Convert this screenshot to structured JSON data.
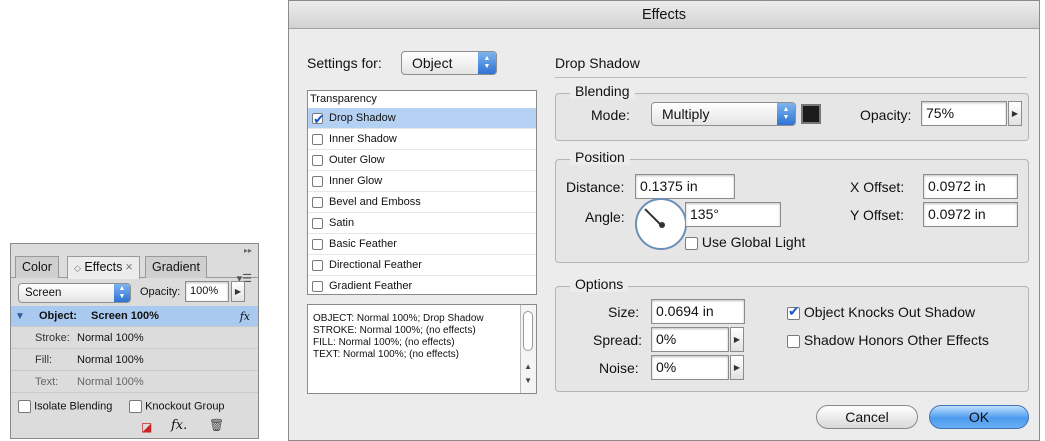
{
  "panel": {
    "tabs": [
      "Color",
      "Effects",
      "Gradient"
    ],
    "blend_mode": "Screen",
    "opacity_label": "Opacity:",
    "opacity_value": "100%",
    "rows": [
      {
        "label": "Object:",
        "value": "Screen 100%"
      },
      {
        "label": "Stroke:",
        "value": "Normal 100%"
      },
      {
        "label": "Fill:",
        "value": "Normal 100%"
      },
      {
        "label": "Text:",
        "value": "Normal 100%"
      }
    ],
    "isolate_blending": "Isolate Blending",
    "knockout_group": "Knockout Group",
    "fx_icon": "fx"
  },
  "dialog": {
    "title": "Effects",
    "settings_for_label": "Settings for:",
    "settings_for_value": "Object",
    "section_title": "Drop Shadow",
    "list_header": "Transparency",
    "effects": [
      {
        "label": "Drop Shadow",
        "checked": true
      },
      {
        "label": "Inner Shadow",
        "checked": false
      },
      {
        "label": "Outer Glow",
        "checked": false
      },
      {
        "label": "Inner Glow",
        "checked": false
      },
      {
        "label": "Bevel and Emboss",
        "checked": false
      },
      {
        "label": "Satin",
        "checked": false
      },
      {
        "label": "Basic Feather",
        "checked": false
      },
      {
        "label": "Directional Feather",
        "checked": false
      },
      {
        "label": "Gradient Feather",
        "checked": false
      }
    ],
    "summary": [
      "OBJECT: Normal 100%; Drop Shadow",
      "STROKE: Normal 100%; (no effects)",
      "FILL: Normal 100%; (no effects)",
      "TEXT: Normal 100%; (no effects)"
    ],
    "blending": {
      "title": "Blending",
      "mode_label": "Mode:",
      "mode_value": "Multiply",
      "opacity_label": "Opacity:",
      "opacity_value": "75%",
      "swatch_color": "#1b1b1b"
    },
    "position": {
      "title": "Position",
      "distance_label": "Distance:",
      "distance_value": "0.1375 in",
      "angle_label": "Angle:",
      "angle_value": "135°",
      "use_global_light": "Use Global Light",
      "x_offset_label": "X Offset:",
      "x_offset_value": "0.0972 in",
      "y_offset_label": "Y Offset:",
      "y_offset_value": "0.0972 in"
    },
    "options": {
      "title": "Options",
      "size_label": "Size:",
      "size_value": "0.0694 in",
      "spread_label": "Spread:",
      "spread_value": "0%",
      "noise_label": "Noise:",
      "noise_value": "0%",
      "knocks_out_shadow": "Object Knocks Out Shadow",
      "honors_other_effects": "Shadow Honors Other Effects"
    },
    "cancel_label": "Cancel",
    "ok_label": "OK"
  },
  "colors": {
    "accent": "#4d9bef",
    "selection": "#b4d0f2"
  }
}
